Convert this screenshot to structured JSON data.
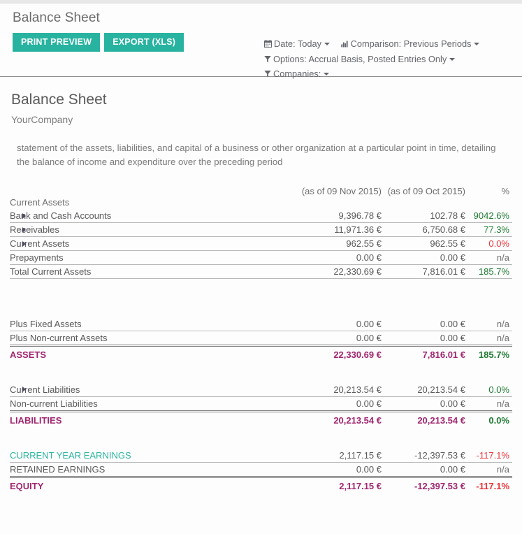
{
  "header": {
    "breadcrumb": "Balance Sheet",
    "buttons": [
      {
        "name": "print-preview",
        "label": "PRINT PREVIEW"
      },
      {
        "name": "export-xls",
        "label": "EXPORT (XLS)"
      }
    ],
    "accent_color": "#27b3a0",
    "filters": {
      "date": {
        "icon": "calendar-icon",
        "label": "Date: Today"
      },
      "comparison": {
        "icon": "bar-chart-icon",
        "label": "Comparison: Previous Periods"
      },
      "options": {
        "icon": "filter-icon",
        "label": "Options: Accrual Basis, Posted Entries Only"
      },
      "companies": {
        "icon": "filter-icon",
        "label": "Companies:"
      }
    }
  },
  "report": {
    "title": "Balance Sheet",
    "company": "YourCompany",
    "description": "statement of the assets, liabilities, and capital of a business or other organization at a particular point in time, detailing the balance of income and expenditure over the preceding period",
    "columns": {
      "name": "",
      "value1": "(as of 09 Nov 2015)",
      "value2": "(as of 09 Oct 2015)",
      "percent": "%"
    },
    "rows": [
      {
        "type": "section",
        "label": "Current Assets",
        "indent": 0,
        "expandable": false
      },
      {
        "type": "row",
        "label": "Bank and Cash Accounts",
        "indent": 1,
        "expandable": true,
        "value1": "9,396.78 €",
        "value2": "102.78 €",
        "percent": "9042.6%",
        "percent_state": "positive"
      },
      {
        "type": "row",
        "label": "Receivables",
        "indent": 1,
        "expandable": true,
        "value1": "11,971.36 €",
        "value2": "6,750.68 €",
        "percent": "77.3%",
        "percent_state": "positive"
      },
      {
        "type": "row",
        "label": "Current Assets",
        "indent": 1,
        "expandable": true,
        "value1": "962.55 €",
        "value2": "962.55 €",
        "percent": "0.0%",
        "percent_state": "negative"
      },
      {
        "type": "row",
        "label": "Prepayments",
        "indent": 1,
        "expandable": false,
        "value1": "0.00 €",
        "value2": "0.00 €",
        "percent": "n/a",
        "percent_state": "neutral"
      },
      {
        "type": "row",
        "label": "Total Current Assets",
        "indent": 1,
        "expandable": false,
        "value1": "22,330.69 €",
        "value2": "7,816.01 €",
        "percent": "185.7%",
        "percent_state": "positive"
      },
      {
        "type": "spacer"
      },
      {
        "type": "row",
        "label": "Plus Fixed Assets",
        "indent": 1,
        "expandable": false,
        "value1": "0.00 €",
        "value2": "0.00 €",
        "percent": "n/a",
        "percent_state": "neutral"
      },
      {
        "type": "row",
        "label": "Plus Non-current Assets",
        "indent": 1,
        "expandable": false,
        "value1": "0.00 €",
        "value2": "0.00 €",
        "percent": "n/a",
        "percent_state": "neutral"
      },
      {
        "type": "total",
        "label": "ASSETS",
        "indent": 0,
        "value1": "22,330.69 €",
        "value2": "7,816.01 €",
        "percent": "185.7%",
        "percent_state": "positive"
      },
      {
        "type": "spacer-sm"
      },
      {
        "type": "row",
        "label": "Current Liabilities",
        "indent": 1,
        "expandable": true,
        "value1": "20,213.54 €",
        "value2": "20,213.54 €",
        "percent": "0.0%",
        "percent_state": "positive"
      },
      {
        "type": "row",
        "label": "Non-current Liabilities",
        "indent": 1,
        "expandable": false,
        "value1": "0.00 €",
        "value2": "0.00 €",
        "percent": "n/a",
        "percent_state": "neutral"
      },
      {
        "type": "total",
        "label": "LIABILITIES",
        "indent": 0,
        "value1": "20,213.54 €",
        "value2": "20,213.54 €",
        "percent": "0.0%",
        "percent_state": "positive"
      },
      {
        "type": "spacer-sm"
      },
      {
        "type": "row",
        "label": "CURRENT YEAR EARNINGS",
        "indent": 1,
        "expandable": false,
        "link": true,
        "value1": "2,117.15 €",
        "value2": "-12,397.53 €",
        "percent": "-117.1%",
        "percent_state": "negative"
      },
      {
        "type": "row",
        "label": "RETAINED EARNINGS",
        "indent": 1,
        "expandable": false,
        "value1": "0.00 €",
        "value2": "0.00 €",
        "percent": "n/a",
        "percent_state": "neutral"
      },
      {
        "type": "total",
        "label": "EQUITY",
        "indent": 0,
        "value1": "2,117.15 €",
        "value2": "-12,397.53 €",
        "percent": "-117.1%",
        "percent_state": "negative"
      }
    ]
  },
  "colors": {
    "accent": "#27b3a0",
    "total": "#a0266f",
    "positive": "#1f7a33",
    "negative": "#e8343a",
    "neutral": "#6d6d6d"
  }
}
